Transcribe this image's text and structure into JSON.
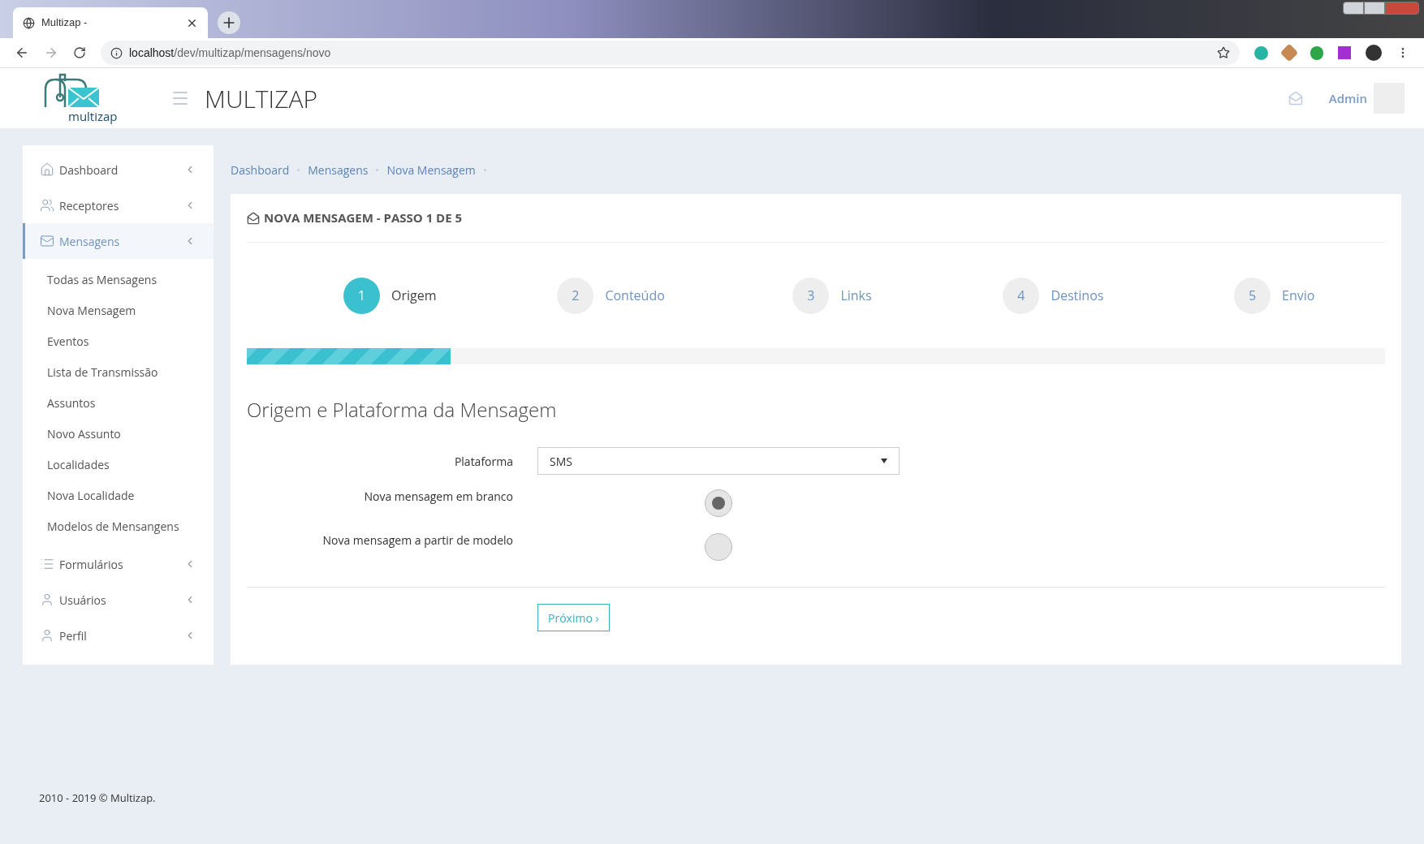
{
  "browser": {
    "tab_title": "Multizap -",
    "url_host": "localhost",
    "url_path": "/dev/multizap/mensagens/novo"
  },
  "header": {
    "logo_text": "multizap",
    "app_title": "MULTIZAP",
    "user": "Admin"
  },
  "sidebar": {
    "items": [
      {
        "label": "Dashboard",
        "kind": "home",
        "selected": false
      },
      {
        "label": "Receptores",
        "kind": "users",
        "selected": false
      },
      {
        "label": "Mensagens",
        "kind": "mail",
        "selected": true,
        "children": [
          {
            "label": "Todas as Mensagens"
          },
          {
            "label": "Nova Mensagem"
          },
          {
            "label": "Eventos"
          },
          {
            "label": "Lista de Transmissão"
          },
          {
            "label": "Assuntos"
          },
          {
            "label": "Novo Assunto"
          },
          {
            "label": "Localidades"
          },
          {
            "label": "Nova Localidade"
          },
          {
            "label": "Modelos de Mensangens"
          }
        ]
      },
      {
        "label": "Formulários",
        "kind": "list",
        "selected": false
      },
      {
        "label": "Usuários",
        "kind": "user",
        "selected": false
      },
      {
        "label": "Perfil",
        "kind": "user",
        "selected": false
      }
    ]
  },
  "breadcrumbs": [
    "Dashboard",
    "Mensagens",
    "Nova Mensagem"
  ],
  "panel": {
    "title": "NOVA MENSAGEM - PASSO 1 DE 5",
    "steps": [
      {
        "number": "1",
        "label": "Origem",
        "selected": true
      },
      {
        "number": "2",
        "label": "Conteúdo",
        "selected": false
      },
      {
        "number": "3",
        "label": "Links",
        "selected": false
      },
      {
        "number": "4",
        "label": "Destinos",
        "selected": false
      },
      {
        "number": "5",
        "label": "Envio",
        "selected": false
      }
    ],
    "progress": {
      "level": 0.179
    },
    "section_title": "Origem e Plataforma da Mensagem",
    "platform": {
      "label": "Plataforma",
      "value": "SMS"
    },
    "options": [
      {
        "label": "Nova mensagem em branco",
        "selected": true
      },
      {
        "label": "Nova mensagem a partir de modelo",
        "selected": false
      }
    ],
    "next_button": "Próximo ›"
  },
  "footer": "2010 - 2019 © Multizap."
}
